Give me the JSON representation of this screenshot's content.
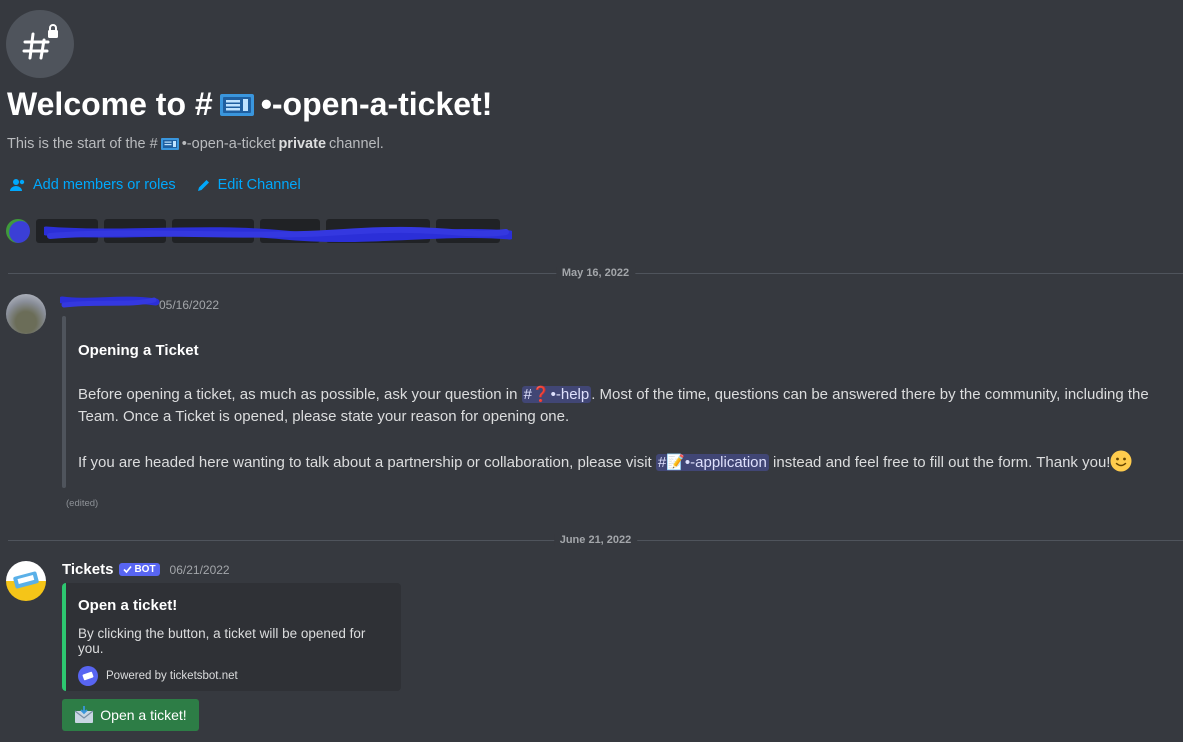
{
  "channel": {
    "welcome_prefix": "Welcome to #",
    "welcome_suffix": "•-open-a-ticket!",
    "start_prefix": "This is the start of the #",
    "start_channel": "•-open-a-ticket",
    "start_bold": "private",
    "start_suffix": "channel."
  },
  "actions": {
    "add_members": "Add members or roles",
    "edit_channel": "Edit Channel"
  },
  "dividers": {
    "first": "May 16, 2022",
    "second": "June 21, 2022"
  },
  "message1": {
    "timestamp": "05/16/2022",
    "embed_title": "Opening a Ticket",
    "p1_before": "Before opening a ticket, as much as possible, ask your question in",
    "help_mention": "#❓•-help",
    "p1_after": ". Most of the time, questions can be answered there by the community, including the Team.  Once a Ticket is opened, please state your reason for opening one.",
    "p2_before": "If you are headed here wanting to talk about a partnership or collaboration, please visit",
    "application_mention": "#📝•-application",
    "p2_after": "instead and feel free to fill out the form. Thank you!",
    "edited": "(edited)"
  },
  "message2": {
    "author": "Tickets",
    "bot_tag": "BOT",
    "timestamp": "06/21/2022",
    "embed_title": "Open a ticket!",
    "embed_desc": "By clicking the button, a ticket will be opened for you.",
    "footer": "Powered by ticketsbot.net",
    "button_label": "Open a ticket!"
  },
  "colors": {
    "background": "#36393f",
    "link": "#00a8fc",
    "embed_accent": "#2dc770",
    "button": "#2d7d46",
    "bot_tag": "#5865f2"
  }
}
